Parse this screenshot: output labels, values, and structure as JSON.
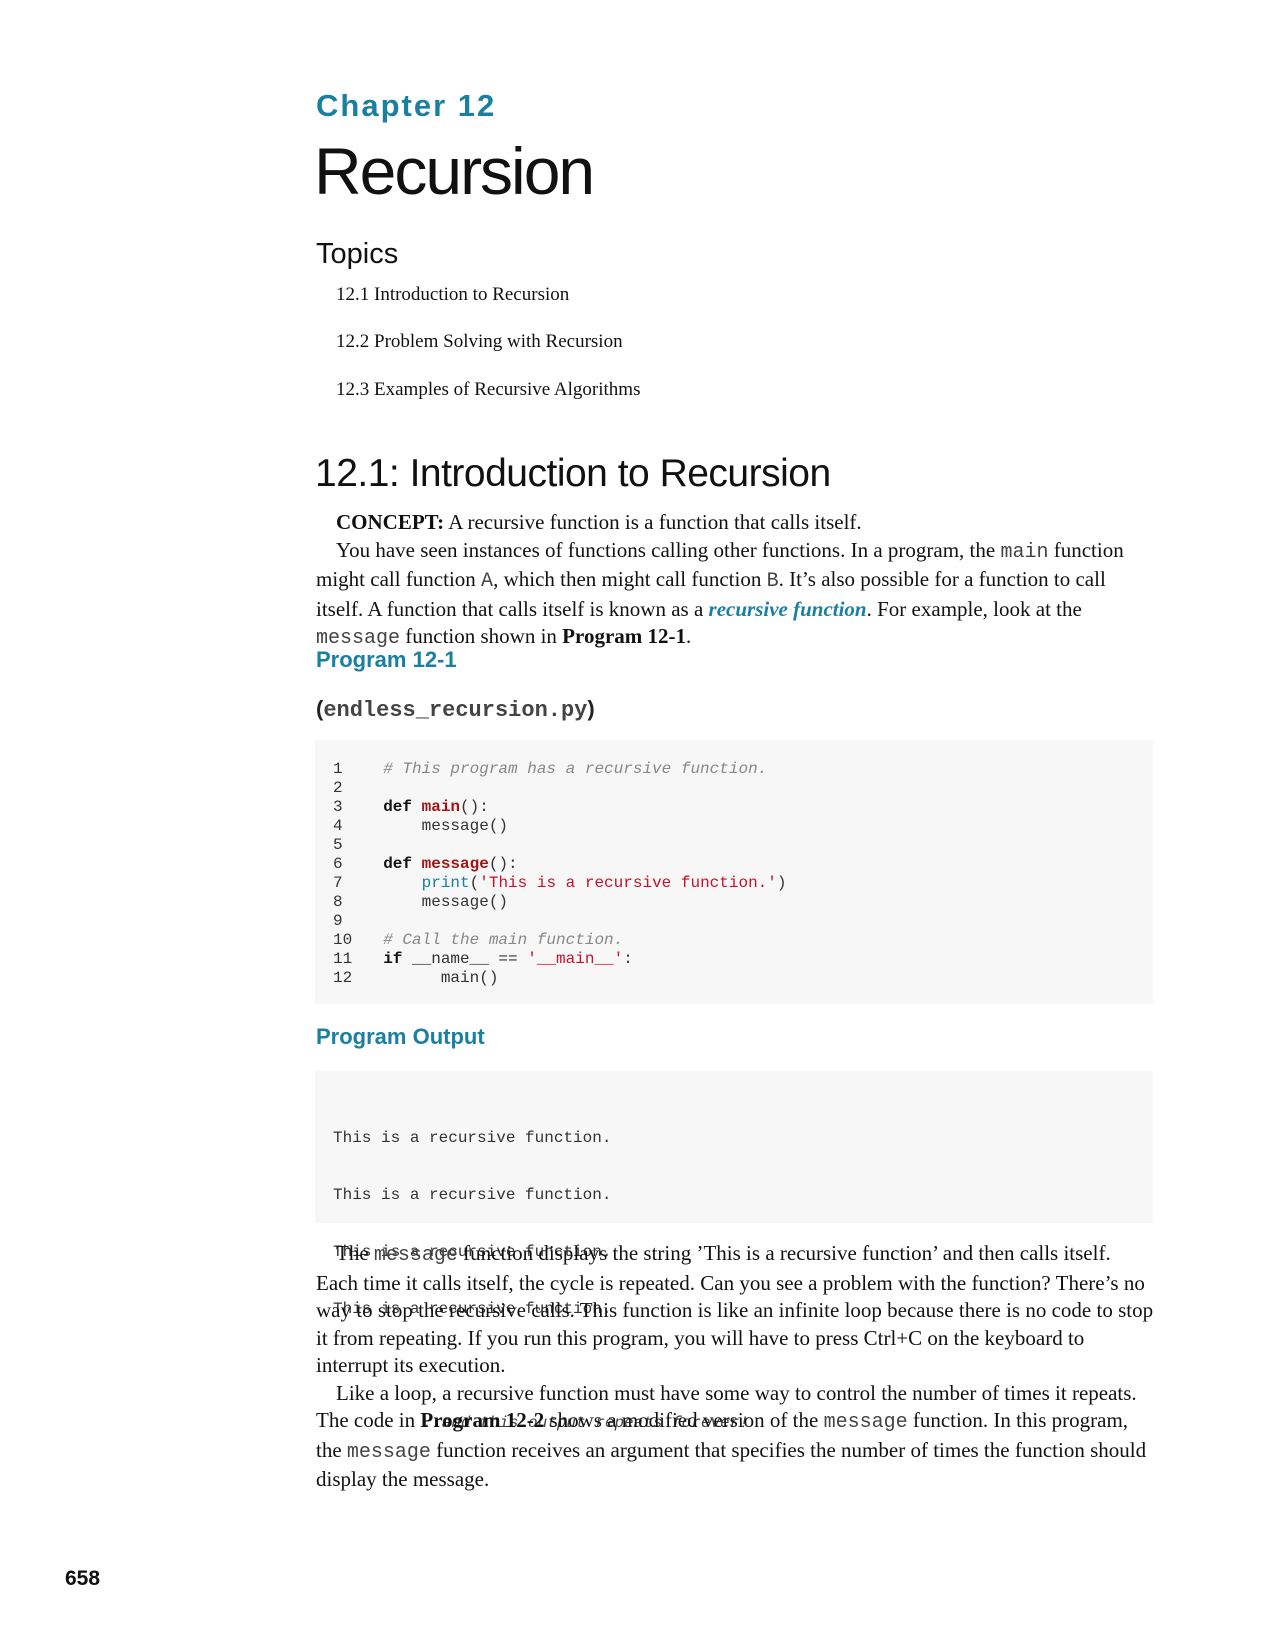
{
  "chapter": {
    "label": "Chapter 12",
    "title": "Recursion"
  },
  "topics": {
    "heading": "Topics",
    "items": [
      "12.1 Introduction to Recursion",
      "12.2 Problem Solving with Recursion",
      "12.3 Examples of Recursive Algorithms"
    ]
  },
  "section": {
    "heading": "12.1: Introduction to Recursion",
    "concept_label": "CONCEPT:",
    "concept_text": " A recursive function is a function that calls itself.",
    "p1": {
      "t1": "You have seen instances of functions calling other functions. In a program, the ",
      "c1": "main",
      "t2": " function might call function ",
      "c2": "A",
      "t3": ", which then might call function ",
      "c3": "B",
      "t4": ". It’s also possible for a function to call itself. A function that calls itself is known as a ",
      "term": "recursive function",
      "t5": ". For example, look at the ",
      "c4": "message",
      "t6": " function shown in ",
      "ref": "Program 12-1",
      "t7": "."
    }
  },
  "program": {
    "heading": "Program 12-1",
    "filename_open": "(",
    "filename": "endless_recursion.py",
    "filename_close": ")",
    "lines": [
      {
        "n": "1",
        "indent": "  ",
        "comment": "# This program has a recursive function."
      },
      {
        "n": "2"
      },
      {
        "n": "3",
        "indent": "  ",
        "kw": "def",
        "fname": "main",
        "rest": "():"
      },
      {
        "n": "4",
        "indent": "      ",
        "rest": "message()"
      },
      {
        "n": "5"
      },
      {
        "n": "6",
        "indent": "  ",
        "kw": "def",
        "fname": "message",
        "rest": "():"
      },
      {
        "n": "7",
        "indent": "      ",
        "builtin": "print",
        "p_open": "(",
        "string": "'This is a recursive function.'",
        "p_close": ")"
      },
      {
        "n": "8",
        "indent": "      ",
        "rest": "message()"
      },
      {
        "n": "9"
      },
      {
        "n": "10",
        "indent": "  ",
        "comment": "# Call the main function."
      },
      {
        "n": "11",
        "indent": "  ",
        "kw": "if",
        "rest": " __name__ == ",
        "string": "'__main__'",
        "p_close": ":"
      },
      {
        "n": "12",
        "indent": "      ",
        "rest": "  main()"
      }
    ]
  },
  "output": {
    "heading": "Program Output",
    "lines": [
      "This is a recursive function.",
      "This is a recursive function.",
      "This is a recursive function.",
      "This is a recursive function."
    ],
    "note": ". . . and this output repeats forever!"
  },
  "body": {
    "p2": {
      "t1": "The ",
      "c1": "message",
      "t2": " function displays the string ’This is a recursive function’ and then calls itself. Each time it calls itself, the cycle is repeated. Can you see a problem with the function? There’s no way to stop the recursive calls. This function is like an infinite loop because there is no code to stop it from repeating. If you run this program, you will have to press Ctrl+C on the keyboard to interrupt its execution."
    },
    "p3": {
      "t1": "Like a loop, a recursive function must have some way to control the number of times it repeats. The code in ",
      "ref": "Program 12-2",
      "t2": " shows a modified version of the ",
      "c1": "message",
      "t3": " function. In this program, the ",
      "c2": "message",
      "t4": " function receives an argument that specifies the number of times the function should display the message."
    }
  },
  "page_number": "658",
  "colors": {
    "accent": "#1a7fa0",
    "code_background": "#f7f7f7",
    "function_name": "#a31515",
    "string": "#c8102e"
  }
}
